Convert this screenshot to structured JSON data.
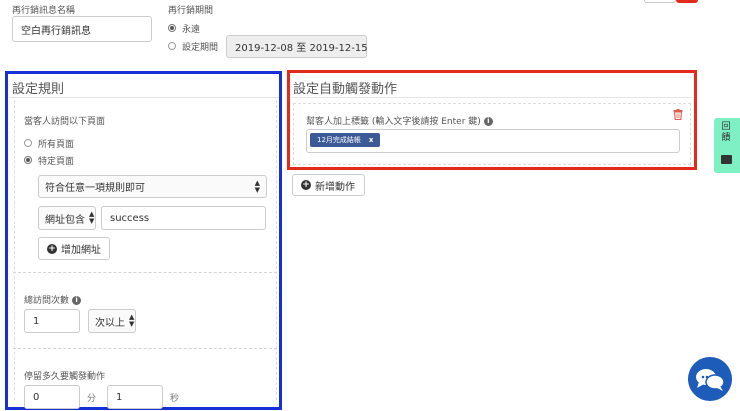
{
  "top": {
    "name_label": "再行銷訊息名稱",
    "name_value": "空白再行銷訊息",
    "period_label": "再行銷期間",
    "option_forever": "永遠",
    "option_set_period": "設定期間",
    "date_range": "2019-12-08 至 2019-12-15"
  },
  "rules": {
    "title": "設定規則",
    "visit_label": "當客人訪問以下頁面",
    "option_all_pages": "所有頁面",
    "option_specific": "特定頁面",
    "match_select": "符合任意一項規則即可",
    "url_condition": "網址包含",
    "url_value": "success",
    "add_url_button": "增加網址",
    "total_visits_label": "總訪問次數",
    "visits_value": "1",
    "visits_select": "次以上",
    "stay_label": "停留多久要觸發動作",
    "minutes_value": "0",
    "minutes_unit": "分",
    "seconds_value": "1",
    "seconds_unit": "秒"
  },
  "actions": {
    "title": "設定自動觸發動作",
    "tag_label": "幫客人加上標籤 (輸入文字後請按 Enter 鍵)",
    "tag_chip": "12月完成結帳",
    "tag_remove": "x",
    "add_action_button": "新增動作"
  },
  "feedback_tab": "回饋",
  "icons": [
    "radio-selected",
    "radio-unselected",
    "info-icon",
    "trash-icon",
    "plus-circle-icon",
    "chat-icon",
    "caret-icon"
  ],
  "colors": {
    "rules_highlight": "#1530d6",
    "actions_highlight": "#e22b1c",
    "tag_bg": "#3b5a97",
    "feedback_tab": "#7ff0c4",
    "chat_bubble": "#1d5cb8"
  }
}
